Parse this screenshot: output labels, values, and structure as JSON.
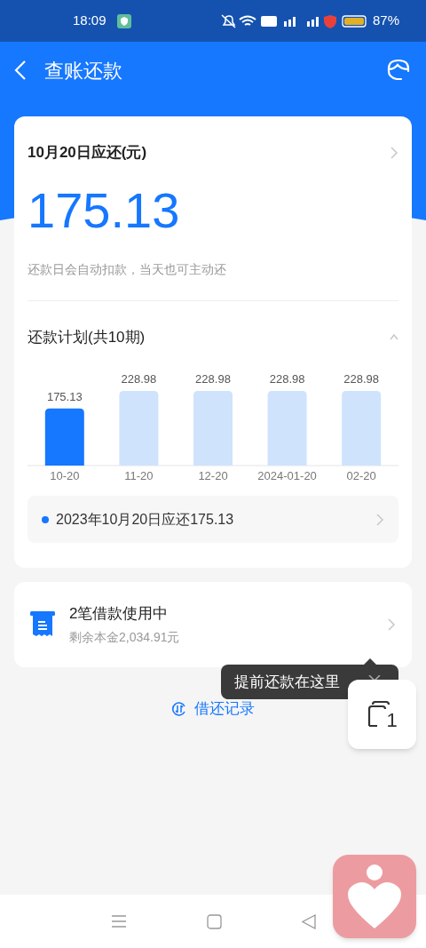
{
  "status_bar": {
    "time": "18:09",
    "battery": "87%"
  },
  "header": {
    "title": "查账还款"
  },
  "due_card": {
    "title": "10月20日应还(元)",
    "amount": "175.13",
    "note": "还款日会自动扣款，当天也可主动还"
  },
  "plan": {
    "title": "还款计划(共10期)",
    "expanded": true,
    "chart_data": {
      "type": "bar",
      "categories": [
        "10-20",
        "11-20",
        "12-20",
        "2024-01-20",
        "02-20"
      ],
      "stacked": true,
      "data_labels": true,
      "series": [
        {
          "color": "#1677ff",
          "values": [
            175.13,
            null,
            null,
            null,
            null
          ]
        },
        {
          "color": "#cfe3fd",
          "values": [
            null,
            228.98,
            228.98,
            228.98,
            228.98
          ]
        }
      ]
    },
    "detail": {
      "text": "2023年10月20日应还175.13",
      "color": "#1677ff"
    }
  },
  "loans": {
    "title": "2笔借款使用中",
    "subtitle": "剩余本金2,034.91元"
  },
  "tooltip": {
    "text": "提前还款在这里"
  },
  "history_link": {
    "label": "借还记录"
  },
  "float_button": {
    "count": "1"
  }
}
